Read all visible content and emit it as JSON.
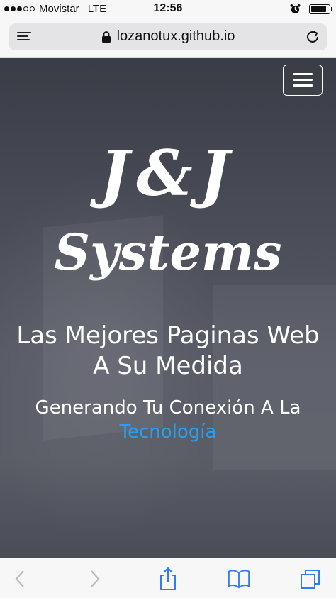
{
  "status_bar": {
    "carrier": "Movistar",
    "network": "LTE",
    "time": "12:56",
    "signal_bars_filled": 3,
    "signal_bars_total": 5,
    "battery_level": 0.85
  },
  "browser": {
    "url": "lozanotux.github.io",
    "reader_icon": "reader-icon",
    "lock_icon": "lock-icon",
    "reload_icon": "reload-icon"
  },
  "site": {
    "menu_icon": "hamburger-menu-icon",
    "brand_line1": "J&J",
    "brand_line2": "Systems",
    "headline_line1": "Las Mejores Paginas Web",
    "headline_line2": "A Su Medida",
    "tagline_line1": "Generando Tu Conexión A La",
    "tagline_accent": "Tecnología"
  },
  "colors": {
    "accent": "#2a9ff0",
    "ios_blue": "#2f7df6"
  },
  "toolbar": {
    "icons": [
      "back-icon",
      "forward-icon",
      "share-icon",
      "bookmarks-icon",
      "tabs-icon"
    ]
  }
}
